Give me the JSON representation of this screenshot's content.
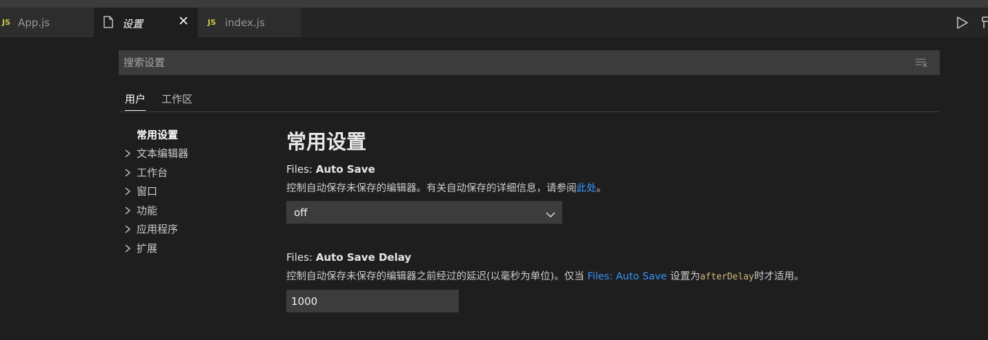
{
  "tabs": [
    {
      "label": "App.js",
      "icon": "JS"
    },
    {
      "label": "设置",
      "icon": "file-icon"
    },
    {
      "label": "index.js",
      "icon": "JS"
    }
  ],
  "search": {
    "placeholder": "搜索设置",
    "value": ""
  },
  "scope_tabs": [
    "用户",
    "工作区"
  ],
  "toc": {
    "items": [
      "常用设置",
      "文本编辑器",
      "工作台",
      "窗口",
      "功能",
      "应用程序",
      "扩展"
    ]
  },
  "content": {
    "section_title": "常用设置",
    "auto_save": {
      "category": "Files: ",
      "name": "Auto Save",
      "desc_prefix": "控制自动保存未保存的编辑器。有关自动保存的详细信息，请参阅",
      "desc_link": "此处",
      "desc_suffix": "。",
      "value": "off"
    },
    "auto_save_delay": {
      "category": "Files: ",
      "name": "Auto Save Delay",
      "desc_prefix": "控制自动保存未保存的编辑器之前经过的延迟(以毫秒为单位)。仅当 ",
      "desc_link": "Files: Auto Save",
      "desc_middle": " 设置为",
      "desc_code": "afterDelay",
      "desc_suffix": "时才适用。",
      "value": "1000"
    }
  },
  "colors": {
    "background": "#1e1e1e",
    "tab_inactive": "#2d2d2d",
    "input_background": "#3c3c3c",
    "link": "#3794ff",
    "js_icon": "#cbcb41"
  }
}
